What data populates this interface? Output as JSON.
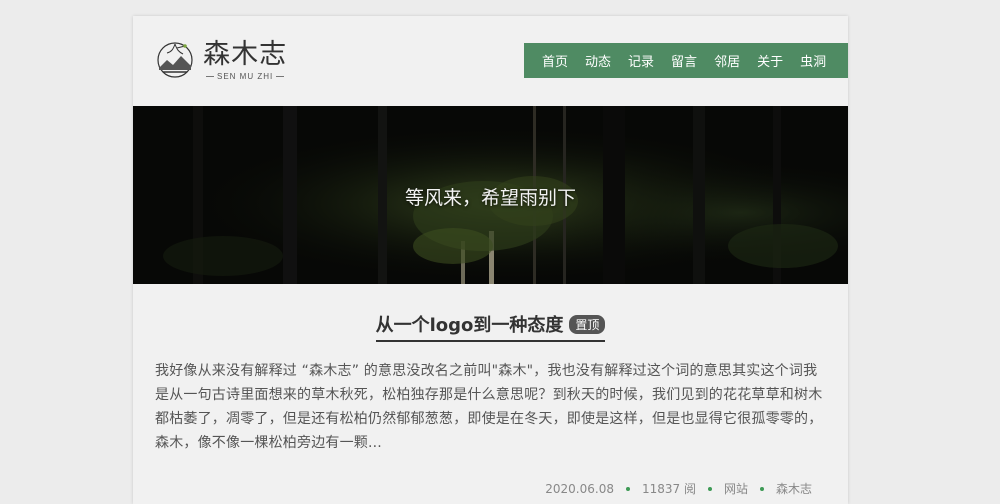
{
  "site": {
    "logo_cn": "森木志",
    "logo_en": "SEN MU ZHI"
  },
  "nav": {
    "items": [
      "首页",
      "动态",
      "记录",
      "留言",
      "邻居",
      "关于",
      "虫洞"
    ],
    "color": "#4f8b63"
  },
  "banner": {
    "text": "等风来，希望雨别下"
  },
  "post": {
    "title": "从一个logo到一种态度",
    "badge": "置顶",
    "excerpt": "我好像从来没有解释过 “森木志” 的意思没改名之前叫\"森木\"，我也没有解释过这个词的意思其实这个词我是从一句古诗里面想来的草木秋死，松柏独存那是什么意思呢？到秋天的时候，我们见到的花花草草和树木都枯萎了，凋零了，但是还有松柏仍然郁郁葱葱，即使是在冬天，即使是这样，但是也显得它很孤零零的，森木，像不像一棵松柏旁边有一颗...",
    "meta": {
      "date": "2020.06.08",
      "views": "11837 阅",
      "category": "网站",
      "author": "森木志"
    }
  },
  "colors": {
    "accent": "#4f8b63",
    "meta_dot": "#3d9a55"
  }
}
